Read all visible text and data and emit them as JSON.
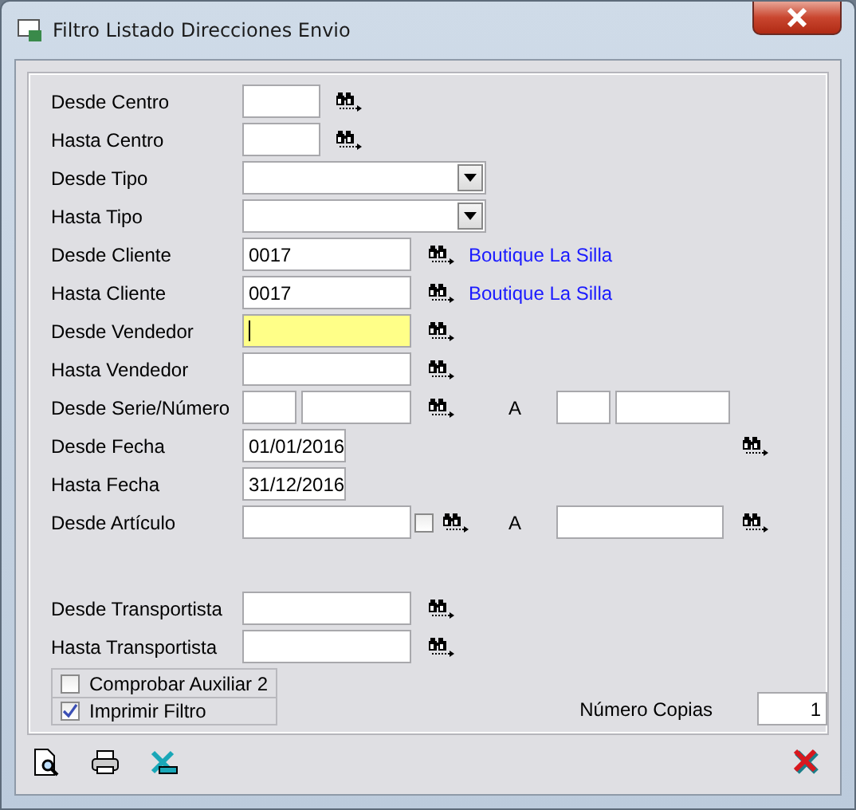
{
  "window": {
    "title": "Filtro Listado Direcciones Envio"
  },
  "rows": [
    {
      "kind": "short",
      "label": "Desde Centro",
      "value": ""
    },
    {
      "kind": "short",
      "label": "Hasta Centro",
      "value": ""
    },
    {
      "kind": "select",
      "label": "Desde Tipo",
      "value": ""
    },
    {
      "kind": "select",
      "label": "Hasta Tipo",
      "value": ""
    },
    {
      "kind": "lookup",
      "label": "Desde Cliente",
      "value": "0017",
      "link": "Boutique La Silla",
      "focused": false
    },
    {
      "kind": "lookup",
      "label": "Hasta Cliente",
      "value": "0017",
      "link": "Boutique La Silla",
      "focused": false
    },
    {
      "kind": "lookup",
      "label": "Desde Vendedor",
      "value": "",
      "focused": true
    },
    {
      "kind": "lookup",
      "label": "Hasta Vendedor",
      "value": "",
      "focused": false
    },
    {
      "kind": "range",
      "label": "Desde Serie/Número",
      "separator": "A"
    },
    {
      "kind": "date",
      "label": "Desde Fecha",
      "value": "01/01/2016",
      "search": true
    },
    {
      "kind": "date",
      "label": "Hasta Fecha",
      "value": "31/12/2016",
      "search": false
    },
    {
      "kind": "article",
      "label": "Desde Artículo",
      "separator": "A",
      "checked": false
    }
  ],
  "transport_rows": [
    {
      "kind": "lookup",
      "label": "Desde Transportista",
      "value": "",
      "focused": false
    },
    {
      "kind": "lookup",
      "label": "Hasta Transportista",
      "value": "",
      "focused": false
    }
  ],
  "options": [
    {
      "label": "Comprobar Auxiliar 2",
      "checked": false
    },
    {
      "label": "Imprimir Filtro",
      "checked": true
    }
  ],
  "copies": {
    "label": "Número Copias",
    "value": "1"
  }
}
